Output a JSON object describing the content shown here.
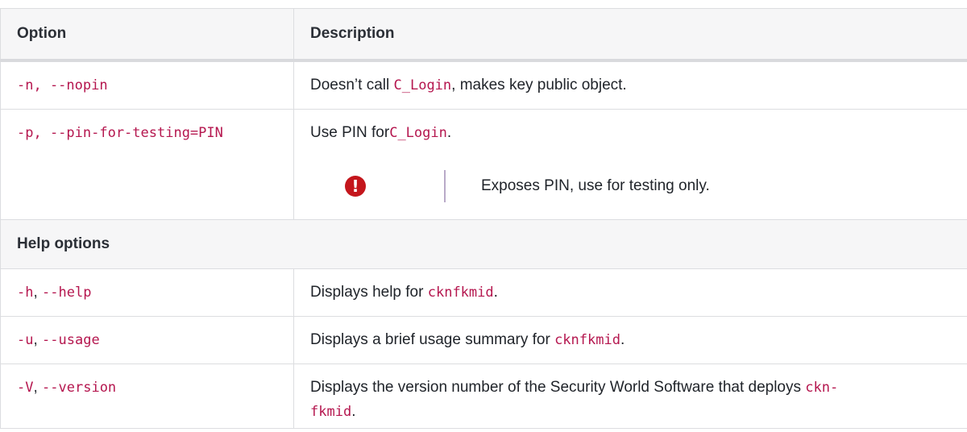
{
  "table": {
    "headers": [
      "Option",
      "Description"
    ],
    "rows": [
      {
        "option": "-n, --nopin",
        "desc_before": "Doesn’t call ",
        "desc_code": "C_Login",
        "desc_after": ", makes key public object."
      },
      {
        "option": "-p, --pin-for-testing=PIN",
        "desc_before": "Use PIN for ",
        "desc_code": "C_Login",
        "desc_after": ".",
        "warning": "Exposes PIN, use for testing only.",
        "warning_icon": "!"
      }
    ],
    "section_help": "Help options",
    "help_rows": [
      {
        "opt_a": "-h",
        "sep": ", ",
        "opt_b": "--help",
        "desc_before": "Displays help for ",
        "desc_code": "cknfkmid",
        "desc_after": "."
      },
      {
        "opt_a": "-u",
        "sep": ", ",
        "opt_b": "--usage",
        "desc_before": "Displays a brief usage summary for ",
        "desc_code": "cknfkmid",
        "desc_after": "."
      },
      {
        "opt_a": "-V",
        "sep": ", ",
        "opt_b": "--version",
        "desc_before": "Displays the version number of the Security World Software that deploys ",
        "desc_code_a": "ckn-",
        "desc_code_b": "fkmid",
        "desc_after": "."
      }
    ]
  },
  "colors": {
    "code": "#b5174f",
    "warning_icon": "#c4161c",
    "header_bg": "#f6f6f7"
  }
}
